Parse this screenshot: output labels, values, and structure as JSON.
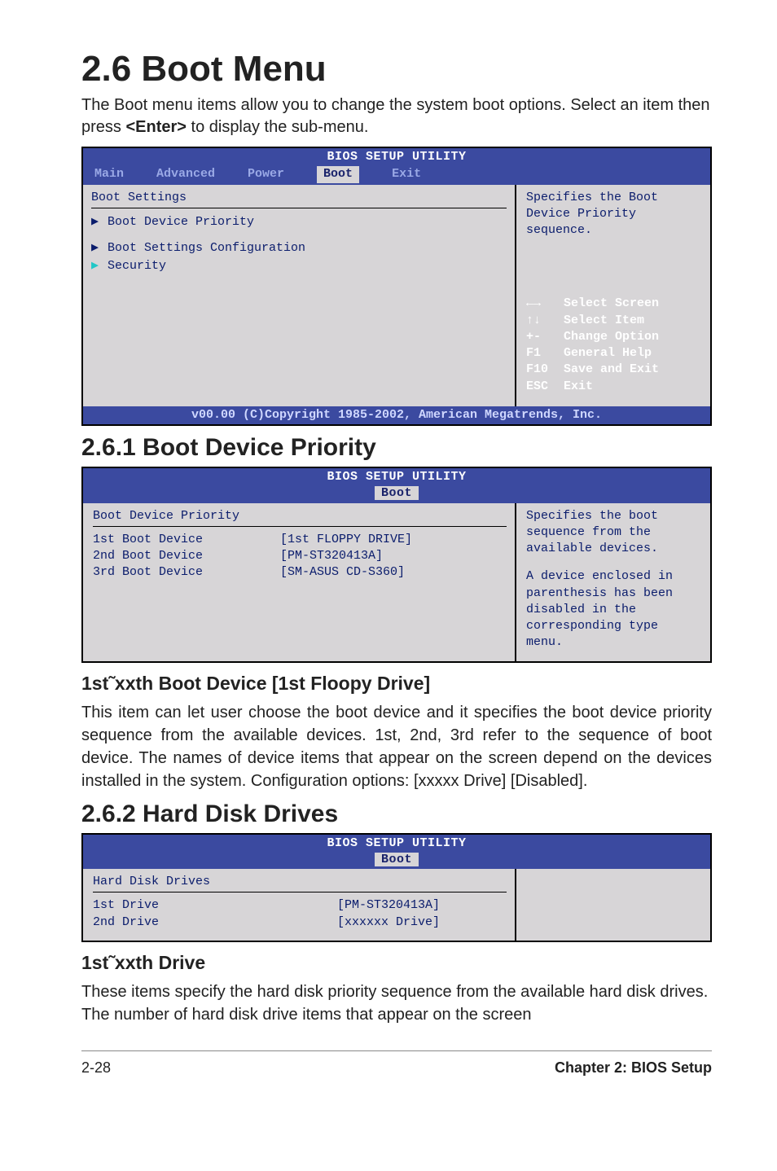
{
  "title": "2.6 Boot Menu",
  "intro_pre": "The Boot menu items allow you to change the system boot options. Select an item then press ",
  "intro_key": "<Enter>",
  "intro_post": " to display the sub-menu.",
  "bios1": {
    "header": "BIOS SETUP UTILITY",
    "tabs": [
      "Main",
      "Advanced",
      "Power",
      "Boot",
      "Exit"
    ],
    "active_tab": "Boot",
    "section_title": "Boot Settings",
    "items": [
      "Boot Device Priority",
      "Boot Settings Configuration",
      "Security"
    ],
    "help_text": "Specifies the Boot Device Priority sequence.",
    "keys": [
      {
        "k": "←→",
        "d": "Select Screen"
      },
      {
        "k": "↑↓",
        "d": "Select Item"
      },
      {
        "k": "+-",
        "d": "Change Option"
      },
      {
        "k": "F1",
        "d": "General Help"
      },
      {
        "k": "F10",
        "d": "Save and Exit"
      },
      {
        "k": "ESC",
        "d": "Exit"
      }
    ],
    "footer": "v00.00 (C)Copyright 1985-2002, American Megatrends, Inc."
  },
  "sec261_title": "2.6.1   Boot Device Priority",
  "bios2": {
    "header": "BIOS SETUP UTILITY",
    "tab": "Boot",
    "section_title": "Boot Device Priority",
    "rows": [
      {
        "lbl": "1st Boot Device",
        "val": "[1st FLOPPY DRIVE]"
      },
      {
        "lbl": "2nd Boot Device",
        "val": "[PM-ST320413A]"
      },
      {
        "lbl": "3rd Boot Device",
        "val": "[SM-ASUS CD-S360]"
      }
    ],
    "help_text_lines": [
      "Specifies the boot",
      "sequence from the",
      "available devices.",
      "",
      "A device enclosed in",
      "parenthesis has been",
      "disabled in the",
      "corresponding type",
      "menu."
    ]
  },
  "h3_1": "1st˜xxth Boot Device [1st Floopy Drive]",
  "p1": "This item can let user choose the boot device and it specifies the boot device priority sequence from the available devices. 1st, 2nd, 3rd refer to the sequence of boot device. The names of device items that appear on the screen depend on the devices installed in the system. Configuration options: [xxxxx Drive] [Disabled].",
  "sec262_title": "2.6.2 Hard Disk Drives",
  "bios3": {
    "header": "BIOS SETUP UTILITY",
    "tab": "Boot",
    "section_title": "Hard Disk Drives",
    "rows": [
      {
        "lbl": "1st Drive",
        "val": "[PM-ST320413A]"
      },
      {
        "lbl": "2nd Drive",
        "val": "[xxxxxx Drive]"
      }
    ]
  },
  "h3_2": "1st˜xxth Drive",
  "p2": "These items specify the hard disk priority sequence from the available hard disk drives. The number of hard disk drive items that appear on the screen",
  "footer_left": "2-28",
  "footer_right": "Chapter 2: BIOS Setup"
}
